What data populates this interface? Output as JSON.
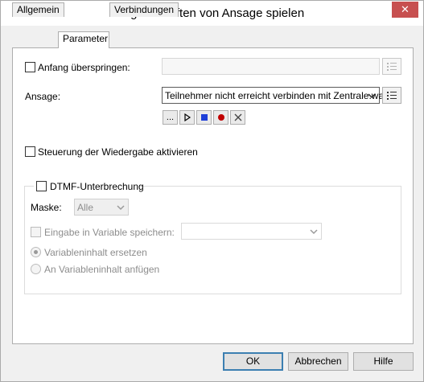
{
  "window": {
    "title": "Eigenschaften von Ansage spielen",
    "close_label": "✕"
  },
  "tabs": [
    {
      "label": "Allgemein",
      "active": false
    },
    {
      "label": "Parameter",
      "active": true
    },
    {
      "label": "Verbindungen",
      "active": false
    }
  ],
  "skip_start": {
    "label": "Anfang überspringen:",
    "checked": false,
    "value": ""
  },
  "announcement": {
    "label": "Ansage:",
    "value": "Teilnehmer nicht erreicht verbinden mit Zentrale.wav",
    "browse_label": "...",
    "controls": [
      "play-icon",
      "stop-icon",
      "record-icon",
      "delete-icon"
    ]
  },
  "playback_control": {
    "label": "Steuerung der Wiedergabe aktivieren",
    "checked": false
  },
  "dtmf": {
    "label": "DTMF-Unterbrechung",
    "checked": false,
    "mask_label": "Maske:",
    "mask_value": "Alle",
    "save_label": "Eingabe in Variable speichern:",
    "save_value": "",
    "replace_label": "Variableninhalt ersetzen",
    "append_label": "An Variableninhalt anfügen",
    "selected": "replace"
  },
  "buttons": {
    "ok": "OK",
    "cancel": "Abbrechen",
    "help": "Hilfe"
  },
  "colors": {
    "close_button": "#c75050",
    "record_dot": "#c00000",
    "stop_square": "#1e3fd8",
    "default_border": "#3c7fb1"
  }
}
